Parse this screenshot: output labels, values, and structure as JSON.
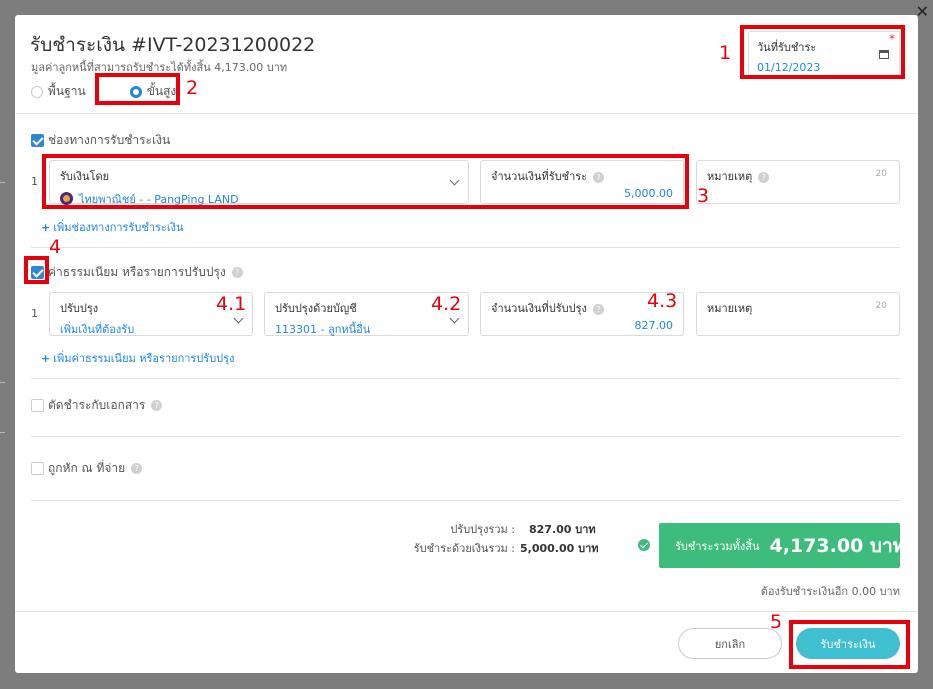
{
  "modal": {
    "title": "รับชำระเงิน #IVT-20231200022",
    "subtitle": "มูลค่าลูกหนี้ที่สามารถรับชำระได้ทั้งสิ้น 4,173.00 บาท",
    "mode_basic": "พื้นฐาน",
    "mode_advanced": "ขั้นสูง",
    "close_glyph": "✕"
  },
  "date_field": {
    "label": "วันที่รับชำระ",
    "required_mark": "*",
    "value": "01/12/2023"
  },
  "payment_channel": {
    "section_label": "ช่องทางการรับชำระเงิน",
    "checked": true,
    "rows": [
      {
        "index": "1",
        "received_by_label": "รับเงินโดย",
        "received_by_value": "ไทยพาณิชย์ - - PangPing LAND",
        "amount_label": "จำนวนเงินที่รับชำระ",
        "amount_value": "5,000.00",
        "note_label": "หมายเหตุ",
        "note_counter": "20"
      }
    ],
    "add_label": "เพิ่มช่องทางการรับชำระเงิน"
  },
  "fees": {
    "section_label": "ค่าธรรมเนียม หรือรายการปรับปรุง",
    "checked": true,
    "rows": [
      {
        "index": "1",
        "adjust_label": "ปรับปรุง",
        "adjust_value": "เพิ่มเงินที่ต้องรับ",
        "account_label": "ปรับปรุงด้วยบัญชี",
        "account_value": "113301 - ลูกหนี้อื่น",
        "amount_label": "จำนวนเงินที่ปรับปรุง",
        "amount_value": "827.00",
        "note_label": "หมายเหตุ",
        "note_counter": "20"
      }
    ],
    "add_label": "เพิ่มค่าธรรมเนียม หรือรายการปรับปรุง"
  },
  "offset_docs": {
    "label": "ตัดชำระกับเอกสาร",
    "checked": false
  },
  "withholding": {
    "label": "ถูกหัก ณ ที่จ่าย",
    "checked": false
  },
  "summary": {
    "adjust_total_label": "ปรับปรุงรวม :",
    "adjust_total_value": "827.00 บาท",
    "paid_total_label": "รับชำระด้วยเงินรวม :",
    "paid_total_value": "5,000.00 บาท",
    "grand_total_label": "รับชำระรวมทั้งสิ้น",
    "grand_total_value": "4,173.00 บาท",
    "remaining": "ต้องรับชำระเงินอีก 0.00 บาท"
  },
  "buttons": {
    "cancel": "ยกเลิก",
    "submit": "รับชำระเงิน"
  },
  "annotations": [
    "1",
    "2",
    "3",
    "4",
    "4.1",
    "4.2",
    "4.3",
    "5"
  ],
  "colors": {
    "accent": "#1e88e5",
    "success": "#3dbc7c",
    "submit": "#3fbfd0",
    "annotation": "#e8000b"
  }
}
